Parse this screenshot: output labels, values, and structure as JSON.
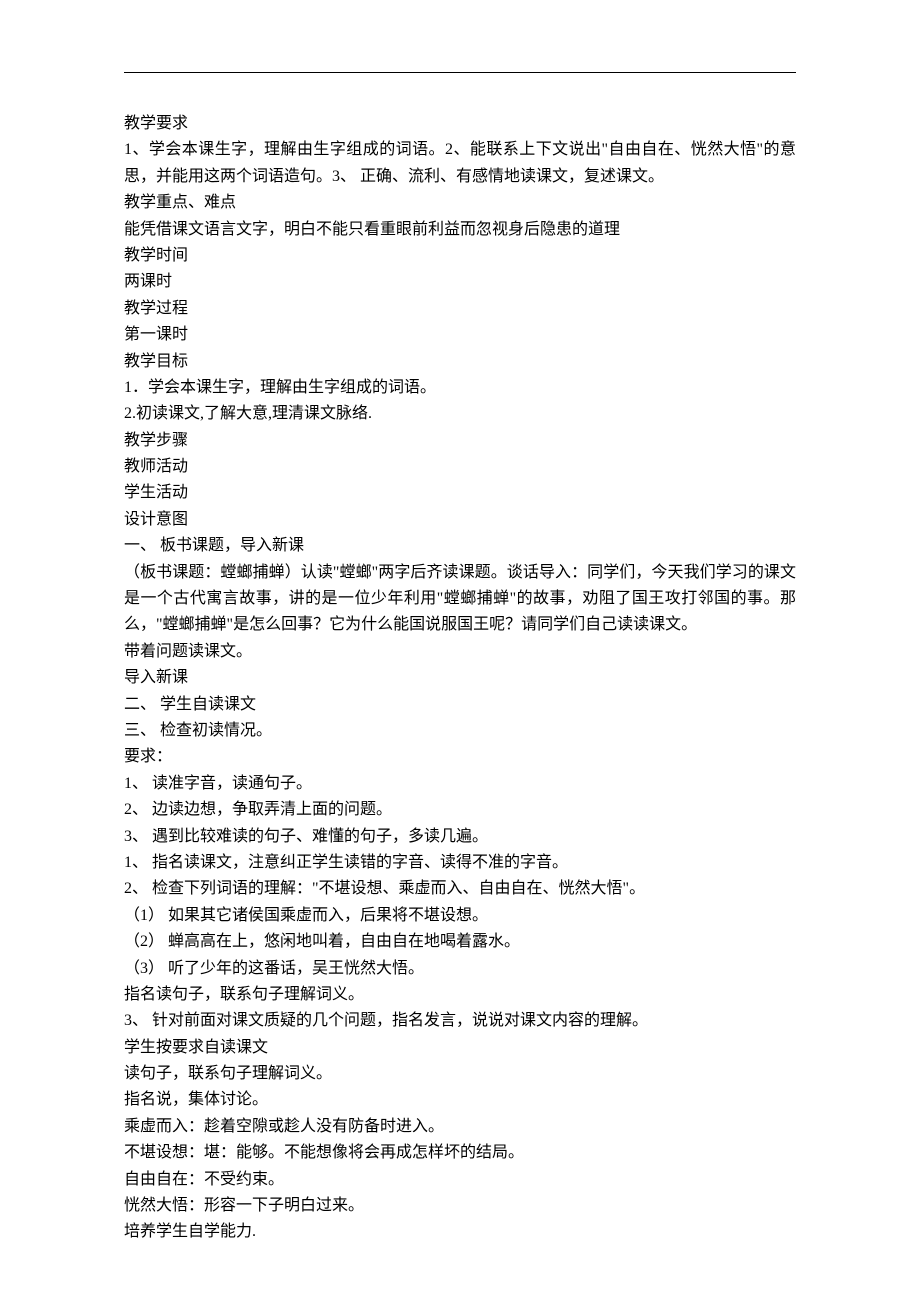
{
  "lines": [
    "教学要求",
    "1、学会本课生字，理解由生字组成的词语。2、能联系上下文说出\"自由自在、恍然大悟\"的意思，并能用这两个词语造句。3、 正确、流利、有感情地读课文，复述课文。",
    "教学重点、难点",
    "能凭借课文语言文字，明白不能只看重眼前利益而忽视身后隐患的道理",
    "教学时间",
    "两课时",
    "教学过程",
    "第一课时",
    "教学目标",
    "1．学会本课生字，理解由生字组成的词语。",
    "2.初读课文,了解大意,理清课文脉络.",
    "教学步骤",
    "教师活动",
    "学生活动",
    "设计意图",
    "一、 板书课题，导入新课",
    "（板书课题：螳螂捕蝉）认读\"螳螂\"两字后齐读课题。谈话导入：同学们，今天我们学习的课文是一个古代寓言故事，讲的是一位少年利用\"螳螂捕蝉\"的故事，劝阻了国王攻打邻国的事。那么，\"螳螂捕蝉\"是怎么回事？它为什么能国说服国王呢？请同学们自己读读课文。",
    "带着问题读课文。",
    "导入新课",
    "二、 学生自读课文",
    "三、 检查初读情况。",
    "要求：",
    "1、 读准字音，读通句子。",
    "2、 边读边想，争取弄清上面的问题。",
    "3、 遇到比较难读的句子、难懂的句子，多读几遍。",
    "1、 指名读课文，注意纠正学生读错的字音、读得不准的字音。",
    "2、 检查下列词语的理解：\"不堪设想、乘虚而入、自由自在、恍然大悟\"。",
    "（1） 如果其它诸侯国乘虚而入，后果将不堪设想。",
    "（2） 蝉高高在上，悠闲地叫着，自由自在地喝着露水。",
    "（3） 听了少年的这番话，吴王恍然大悟。",
    "指名读句子，联系句子理解词义。",
    "3、 针对前面对课文质疑的几个问题，指名发言，说说对课文内容的理解。",
    "学生按要求自读课文",
    "读句子，联系句子理解词义。",
    "指名说，集体讨论。",
    "乘虚而入：趁着空隙或趁人没有防备时进入。",
    "不堪设想：堪：能够。不能想像将会再成怎样坏的结局。",
    "自由自在：不受约束。",
    "恍然大悟：形容一下子明白过来。",
    "培养学生自学能力."
  ]
}
